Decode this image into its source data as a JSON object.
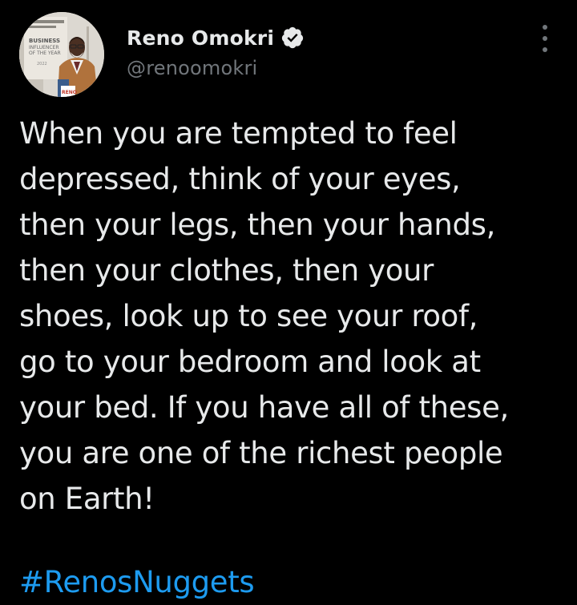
{
  "author": {
    "display_name": "Reno Omokri",
    "handle": "@renoomokri",
    "verified": true,
    "avatar_icon": "profile-photo",
    "avatar_sign_lines": [
      "BUSINESS",
      "INFLUENCER",
      "OF THE YEAR",
      "2022"
    ],
    "avatar_logo_text": "RENO"
  },
  "tweet": {
    "text": "When you are tempted to feel\ndepressed, think of your eyes,\nthen your legs, then your hands,\nthen your clothes, then your\nshoes, look up to see your roof,\ngo to your bedroom and look at\nyour bed. If you have all of these,\nyou are one of the richest people\non Earth!",
    "hashtag": "#RenosNuggets"
  },
  "icons": {
    "verified": "verified-badge-icon",
    "more": "more-options-icon"
  },
  "colors": {
    "background": "#000000",
    "primary_text": "#e7e9ea",
    "secondary_text": "#71767b",
    "link": "#1d9bf0"
  }
}
